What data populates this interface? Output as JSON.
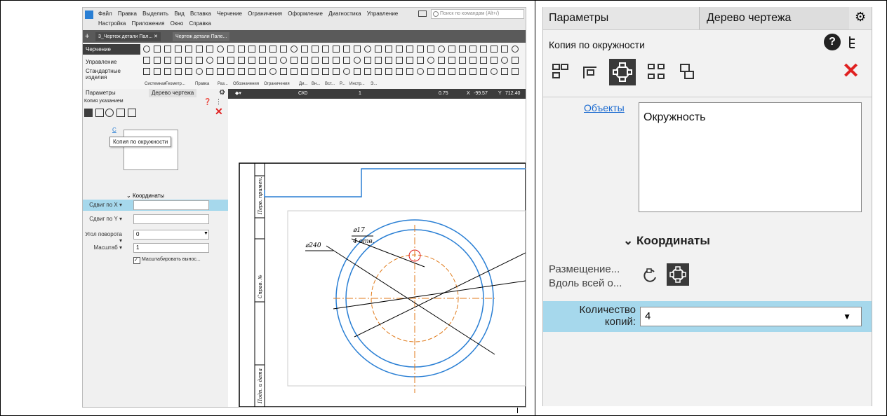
{
  "left_window": {
    "menu": [
      "Файл",
      "Правка",
      "Выделить",
      "Вид",
      "Вставка",
      "Черчение",
      "Ограничения",
      "Оформление",
      "Диагностика",
      "Управление"
    ],
    "menu_row2": [
      "Настройка",
      "Приложения",
      "Окно",
      "Справка"
    ],
    "search_placeholder": "Поиск по командам (Alt+/)",
    "doc_tabs": [
      "3_Чертеж детали Пал... ✕",
      "Чертеж детали Пале..."
    ],
    "ribbon_items": [
      "Черчение",
      "Управление",
      "Стандартные изделия"
    ],
    "toolbar_labels": [
      "Системная",
      "Геометр...",
      "Правка",
      "Раз...",
      "Обозначения",
      "Ограничения",
      "Ди...",
      "Вн...",
      "Вст...",
      "Р...",
      "Инстр...",
      "Э..."
    ],
    "panel_tabs": [
      "Параметры",
      "Дерево чертежа"
    ],
    "panel_title": "Копия указанием",
    "tooltip": "Копия по окружности",
    "objects_link": "С",
    "coords_header": "Координаты",
    "rows": [
      {
        "label": "Сдвиг по X ▾",
        "value": ""
      },
      {
        "label": "Сдвиг по Y ▾",
        "value": ""
      },
      {
        "label": "Угол поворота ▾",
        "value": "0"
      },
      {
        "label": "Масштаб ▾",
        "value": "1"
      }
    ],
    "checkbox_label": "Масштабировать вынос...",
    "view_toolbar": {
      "ck": "СК0",
      "x_label": "X",
      "x_value": "-99.57",
      "y_label": "Y",
      "y_value": "712.40",
      "zoom": "0.75",
      "step": "1"
    },
    "drawing": {
      "dim1": "⌀17",
      "dim1b": "4 отв.",
      "dim2": "⌀240",
      "stamp1": "Перв. примен.",
      "stamp2": "Справ. №",
      "stamp3": "Подп. и дата"
    }
  },
  "right_panel": {
    "tab_params": "Параметры",
    "tab_tree": "Дерево чертежа",
    "title": "Копия по окружности",
    "objects_link": "Объекты",
    "objects_value": "Окружность",
    "coords_header": "Координаты",
    "placement_label1": "Размещение...",
    "placement_label2": "Вдоль всей о...",
    "count_label1": "Количество",
    "count_label2": "копий:",
    "count_value": "4"
  },
  "colors": {
    "accent_blue": "#2a7fd4",
    "highlight_row": "#a6d8ec",
    "close_red": "#e02020",
    "orange_lines": "#e07a1a"
  }
}
